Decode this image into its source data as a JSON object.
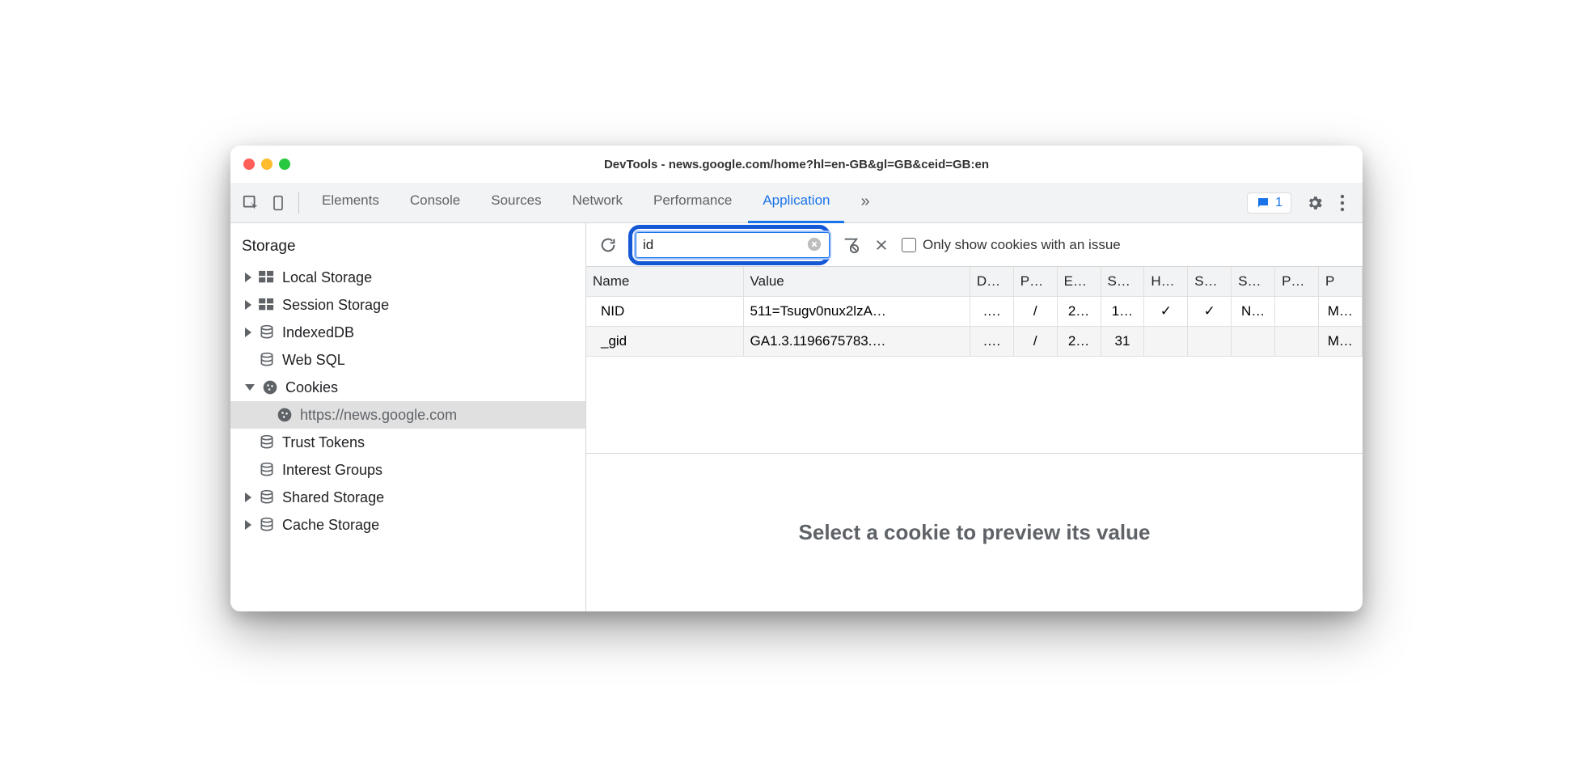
{
  "window": {
    "title": "DevTools - news.google.com/home?hl=en-GB&gl=GB&ceid=GB:en"
  },
  "tabs": {
    "items": [
      "Elements",
      "Console",
      "Sources",
      "Network",
      "Performance",
      "Application"
    ],
    "active": "Application",
    "overflow_glyph": "»",
    "issues_count": "1"
  },
  "sidebar": {
    "heading": "Storage",
    "items": [
      {
        "label": "Local Storage",
        "icon": "storage",
        "expandable": true
      },
      {
        "label": "Session Storage",
        "icon": "storage",
        "expandable": true
      },
      {
        "label": "IndexedDB",
        "icon": "db",
        "expandable": true
      },
      {
        "label": "Web SQL",
        "icon": "db",
        "expandable": false
      },
      {
        "label": "Cookies",
        "icon": "cookie",
        "expandable": true,
        "expanded": true
      },
      {
        "label": "https://news.google.com",
        "icon": "cookie",
        "child": true,
        "selected": true
      },
      {
        "label": "Trust Tokens",
        "icon": "db",
        "expandable": false
      },
      {
        "label": "Interest Groups",
        "icon": "db",
        "expandable": false
      },
      {
        "label": "Shared Storage",
        "icon": "db",
        "expandable": true
      },
      {
        "label": "Cache Storage",
        "icon": "db",
        "expandable": true
      }
    ]
  },
  "toolbar": {
    "filter_value": "id",
    "checkbox_label": "Only show cookies with an issue"
  },
  "table": {
    "columns": [
      "Name",
      "Value",
      "D…",
      "P…",
      "E…",
      "S…",
      "H…",
      "S…",
      "S…",
      "P…",
      "P"
    ],
    "rows": [
      {
        "cells": [
          "NID",
          "511=Tsugv0nux2lzA…",
          "….",
          "/",
          "2…",
          "1…",
          "✓",
          "✓",
          "N…",
          "",
          "M…"
        ]
      },
      {
        "cells": [
          "_gid",
          "GA1.3.1196675783.…",
          "….",
          "/",
          "2…",
          "31",
          "",
          "",
          "",
          "",
          "M…"
        ]
      }
    ]
  },
  "preview": {
    "placeholder": "Select a cookie to preview its value"
  }
}
